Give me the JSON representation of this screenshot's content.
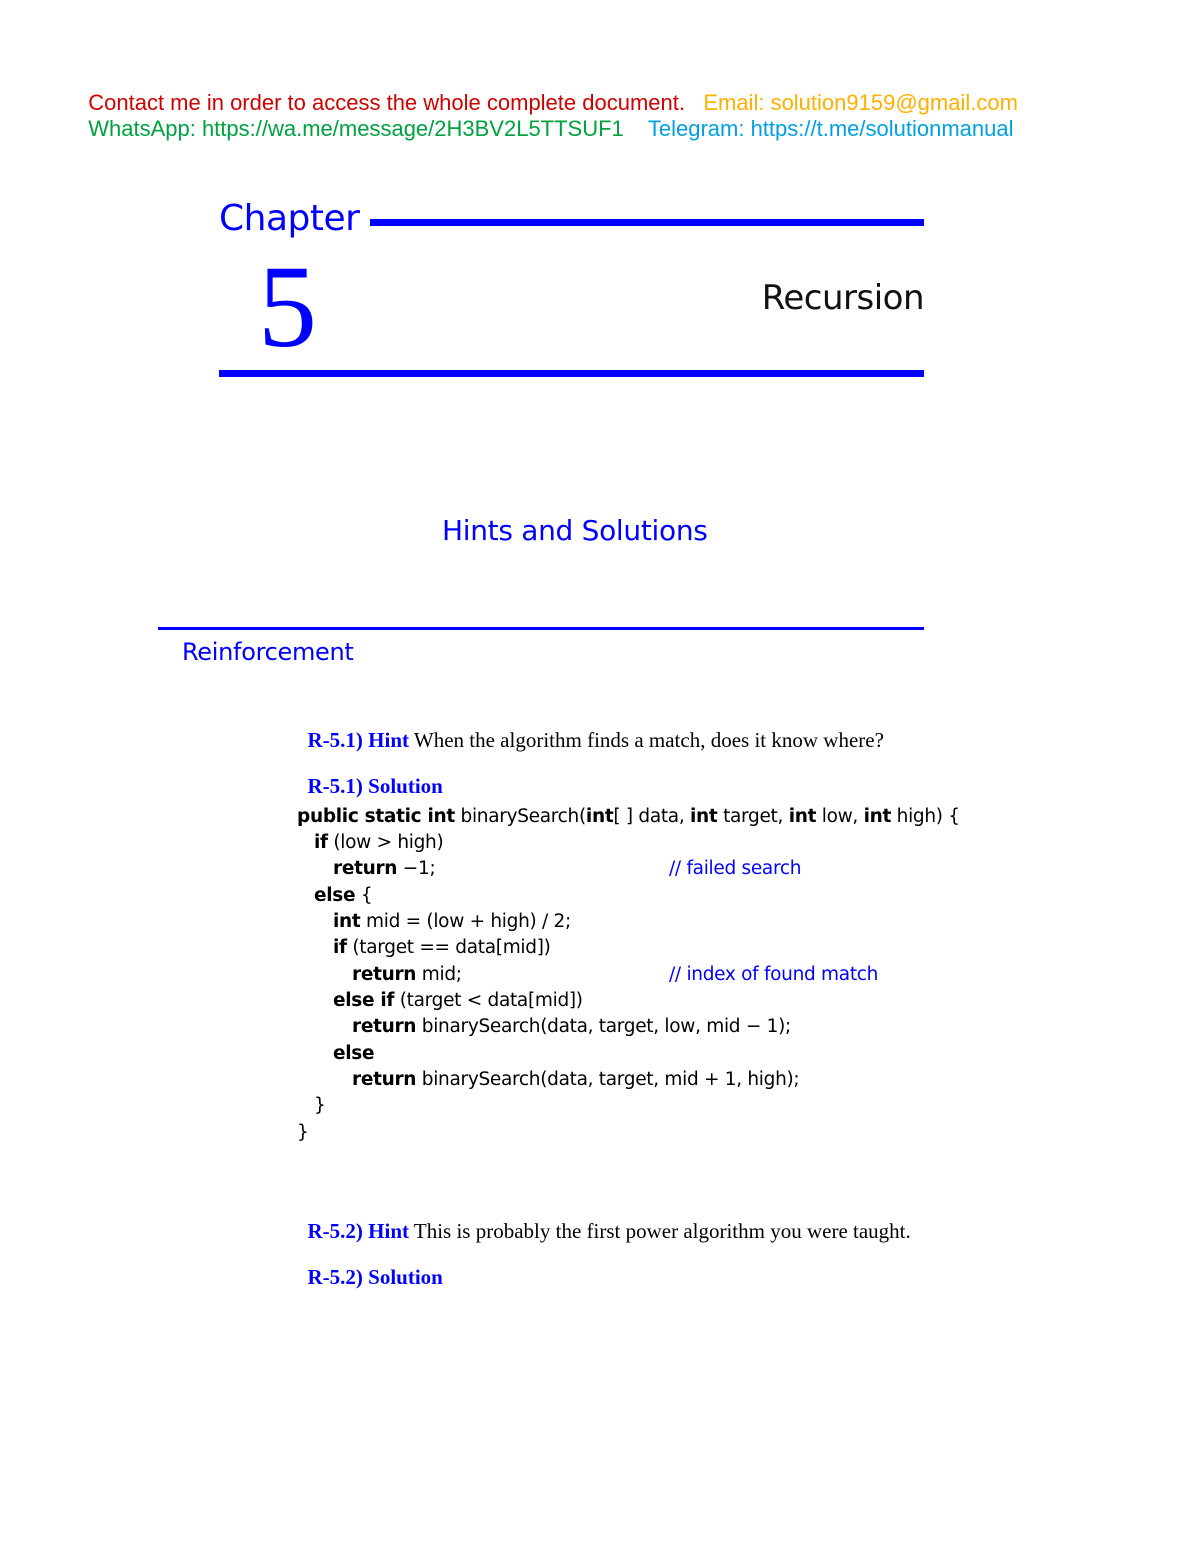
{
  "contact_banner": {
    "line1": {
      "contact": "Contact me in order to access the whole complete document.",
      "email": "Email: solution9159@gmail.com"
    },
    "line2": {
      "whatsapp": "WhatsApp: https://wa.me/message/2H3BV2L5TTSUF1",
      "telegram": "Telegram: https://t.me/solutionmanual"
    },
    "colors": {
      "contact": "#cc0000",
      "email": "#ffb000",
      "whatsapp": "#00a040",
      "telegram": "#00a0e0"
    }
  },
  "chapter": {
    "word": "Chapter",
    "number": "5",
    "title": "Recursion",
    "accent_color": "#0000ff"
  },
  "heading": "Hints and Solutions",
  "section": "Reinforcement",
  "problems": [
    {
      "label": "R-5.1) Hint",
      "text": "When the algorithm finds a match, does it know where?"
    },
    {
      "label": "R-5.1) Solution",
      "text": ""
    },
    {
      "label": "R-5.2) Hint",
      "text": "This is probably the first power algorithm you were taught."
    },
    {
      "label": "R-5.2) Solution",
      "text": ""
    }
  ],
  "code": {
    "lines": [
      {
        "kw": "public static int",
        "rest": " binarySearch(",
        "kw2": "int",
        "rest2": "[ ] data, ",
        "kw3": "int",
        "rest3": " target, ",
        "kw4": "int",
        "rest4": " low, ",
        "kw5": "int",
        "rest5": " high) {"
      },
      {
        "kw": "if",
        "rest": " (low > high)"
      },
      {
        "kw": "return",
        "rest": " −1;",
        "comment": "// failed search"
      },
      {
        "kw": "else",
        "rest": " {"
      },
      {
        "kw": "int",
        "rest": " mid = (low + high) / 2;"
      },
      {
        "kw": "if",
        "rest": " (target == data[mid])"
      },
      {
        "kw": "return",
        "rest": " mid;",
        "comment": "// index of found match"
      },
      {
        "kw": "else if",
        "rest": " (target < data[mid])"
      },
      {
        "kw": "return",
        "rest": " binarySearch(data, target, low, mid − 1);"
      },
      {
        "kw": "else",
        "rest": ""
      },
      {
        "kw": "return",
        "rest": " binarySearch(data, target, mid + 1, high);"
      },
      {
        "kw": "",
        "rest": "}"
      },
      {
        "kw": "",
        "rest": "}"
      }
    ]
  }
}
